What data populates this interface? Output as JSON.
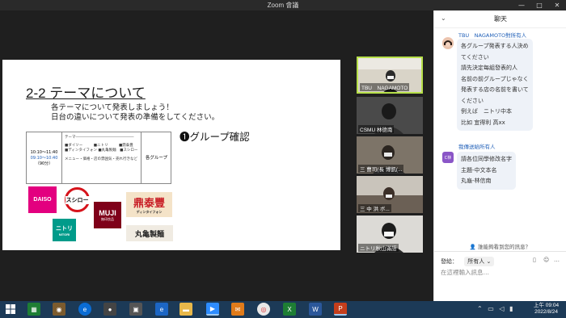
{
  "window": {
    "title": "Zoom 會議"
  },
  "slide": {
    "title": "2-2 テーマについて",
    "line1": "各テーマについて発表しましょう！",
    "line2": "日台の違いについて発表の準備をしてください。",
    "group_check": "❶グループ確認",
    "schedule": {
      "time1": "10:10～11:40",
      "time2": "09:10～10:40",
      "duration": "（90分）",
      "theme_label": "テーマ――――――――――――――――",
      "themes": "■ダイソー　　　■ニトリ　　　■鼎泰豊\n■ディンタイフォン ■丸亀製麺　■スシロー",
      "menu_note": "メニュー・価格・店の雰囲気・売れ行きなど",
      "right_label": "各グループ"
    },
    "logos": {
      "daiso": "DAISO",
      "sushiro": "スシロー",
      "muji": "MUJI",
      "muji_sub": "無印良品",
      "dintaifung": "鼎泰豐",
      "dintaifung_sub": "ディンタイフォン",
      "nitori": "ニトリ",
      "nitori_sub": "NITORI",
      "marugame": "丸亀製麺"
    }
  },
  "participants": [
    {
      "label": "TBU　NAGAMOTO"
    },
    {
      "label": "CSMU 林德南"
    },
    {
      "label": "三 曹司(長 博凱(..."
    },
    {
      "label": "三 中 洪 ボ..."
    },
    {
      "label": "ニトリ秋山滿語"
    }
  ],
  "chat": {
    "title": "聊天",
    "messages": [
      {
        "sender": "TBU　NAGAMOTO對所有人",
        "lines": [
          "各グループ発表する人決め",
          "てください",
          "請先決定每組發表的人",
          "名前の前グループじゃなく",
          "発表する店の名前を書いて",
          "ください",
          "例えば　ニトリ中本",
          "比如 宜得利 高xx"
        ]
      },
      {
        "sender": "我傳送給所有人",
        "avatar_text": "C林",
        "lines": [
          "請各位同學修改名字",
          "主題-中文本名",
          "丸龜-林信南"
        ]
      }
    ],
    "who_can_see": "誰能夠看到您的訊息？",
    "send_to_label": "發給：",
    "recipient": "所有人",
    "input_placeholder": "在這裡輸入訊息…"
  },
  "taskbar": {
    "clock_time": "上午 09:04",
    "clock_date": "2022/8/24"
  }
}
